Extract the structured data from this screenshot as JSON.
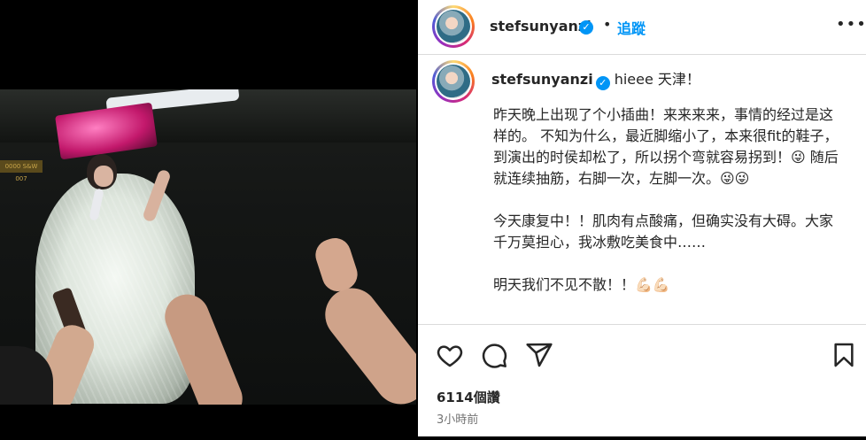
{
  "post": {
    "username": "stefsunyanzi",
    "follow_label": "追蹤",
    "dot": "•",
    "more_label": "•••"
  },
  "photo": {
    "sign_text": "0000 S&W 007"
  },
  "caption": {
    "username": "stefsunyanzi",
    "first_line": "hieee 天津！",
    "body": "昨天晚上出现了个小插曲！来来来来，事情的经过是这样的。 不知为什么，最近脚缩小了，本来很fit的鞋子，到演出的时侯却松了，所以拐个弯就容易拐到！😜 随后就连续抽筋，右脚一次，左脚一次。😜😜\n\n今天康复中！！肌肉有点酸痛，但确实没有大碍。大家千万莫担心，我冰敷吃美食中……\n\n明天我们不见不散！！💪🏻💪🏻"
  },
  "stats": {
    "likes": "6114個讚",
    "time": "3小時前"
  },
  "colors": {
    "accent": "#0095f6",
    "text": "#262626",
    "muted": "#737373",
    "border": "#dbdbdb"
  },
  "icons": [
    "heart-icon",
    "comment-icon",
    "share-icon",
    "bookmark-icon",
    "verified-icon",
    "more-icon"
  ]
}
